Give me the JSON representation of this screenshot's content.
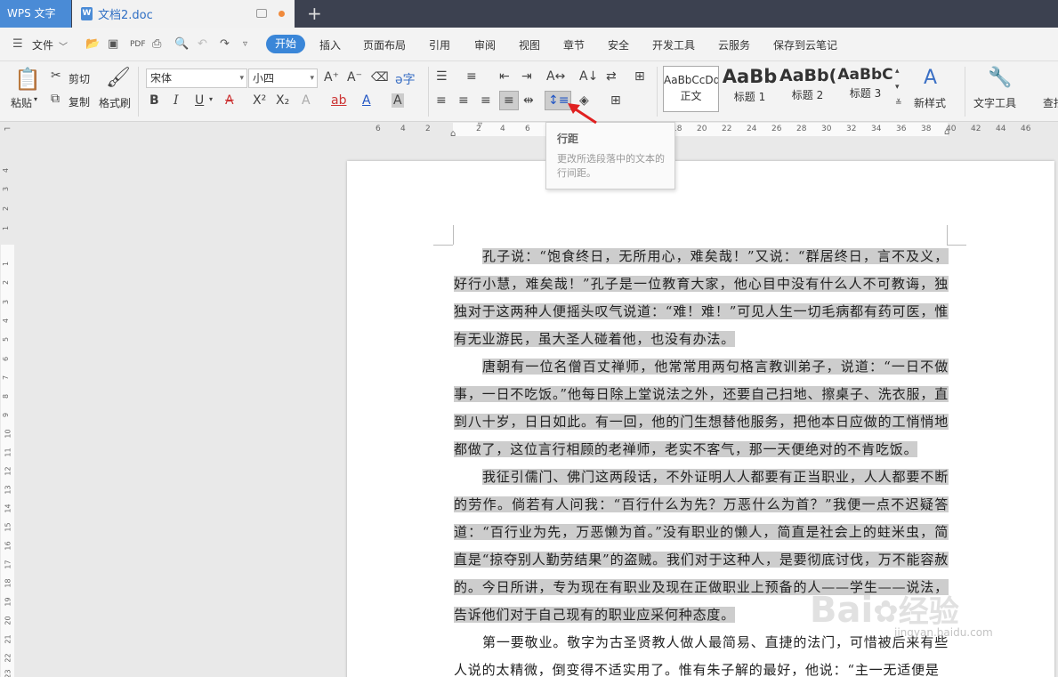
{
  "titlebar": {
    "app_name": "WPS 文字",
    "doc_tab": "文档2.doc",
    "new_tab": "+"
  },
  "menu": {
    "file": "文件",
    "items": [
      "开始",
      "插入",
      "页面布局",
      "引用",
      "审阅",
      "视图",
      "章节",
      "安全",
      "开发工具",
      "云服务",
      "保存到云笔记"
    ],
    "active_index": 0,
    "accent": "#3a86d8"
  },
  "ribbon": {
    "paste": "粘贴",
    "cut": "剪切",
    "copy": "复制",
    "format_painter": "格式刷",
    "font_name": "宋体",
    "font_size": "小四",
    "styles": [
      {
        "preview": "AaBbCcDd",
        "label": "正文"
      },
      {
        "preview": "AaBb",
        "label": "标题 1"
      },
      {
        "preview": "AaBb(",
        "label": "标题 2"
      },
      {
        "preview": "AaBbC",
        "label": "标题 3"
      }
    ],
    "new_style": "新样式",
    "text_tools": "文字工具",
    "find": "查找"
  },
  "ruler": {
    "h_numbers": [
      "6",
      "4",
      "2",
      "2",
      "4",
      "6",
      "8",
      "10",
      "12",
      "14",
      "16",
      "18",
      "20",
      "22",
      "24",
      "26",
      "28",
      "30",
      "32",
      "34",
      "36",
      "38",
      "40",
      "42",
      "44",
      "46"
    ],
    "v_numbers": [
      "4",
      "3",
      "2",
      "1",
      "1",
      "2",
      "3",
      "4",
      "5",
      "6",
      "7",
      "8",
      "9",
      "10",
      "11",
      "12",
      "13",
      "14",
      "15",
      "16",
      "17",
      "18",
      "19",
      "20",
      "21",
      "22",
      "23"
    ]
  },
  "tooltip": {
    "title": "行距",
    "description": "更改所选段落中的文本的行间距。"
  },
  "document": {
    "paragraphs": [
      "孔子说：“饱食终日，无所用心，难矣哉！”又说：“群居终日，言不及义，好行小慧，难矣哉！”孔子是一位教育大家，他心目中没有什么人不可教诲，独独对于这两种人便摇头叹气说道：“难！难！”可见人生一切毛病都有药可医，惟有无业游民，虽大圣人碰着他，也没有办法。",
      "唐朝有一位名僧百丈禅师，他常常用两句格言教训弟子，说道：“一日不做事，一日不吃饭。”他每日除上堂说法之外，还要自己扫地、擦桌子、洗衣服，直到八十岁，日日如此。有一回，他的门生想替他服务，把他本日应做的工悄悄地都做了，这位言行相顾的老禅师，老实不客气，那一天便绝对的不肯吃饭。",
      "我征引儒门、佛门这两段话，不外证明人人都要有正当职业，人人都要不断的劳作。倘若有人问我：“百行什么为先？万恶什么为首？”我便一点不迟疑答道：“百行业为先，万恶懒为首。”没有职业的懒人，简直是社会上的蛀米虫，简直是“掠夺别人勤劳结果”的盗贼。我们对于这种人，是要彻底讨伐，万不能容赦的。今日所讲，专为现在有职业及现在正做职业上预备的人——学生——说法，告诉他们对于自己现有的职业应采何种态度。",
      "第一要敬业。敬字为古圣贤教人做人最简易、直捷的法门，可惜被后来有些人说的太精微，倒变得不适实用了。惟有朱子解的最好，他说：“主一无适便是"
    ]
  },
  "watermark": {
    "text": "Bai",
    "icon": "paw-icon",
    "text2": "经验",
    "sub": "jingyan.baidu.com"
  }
}
